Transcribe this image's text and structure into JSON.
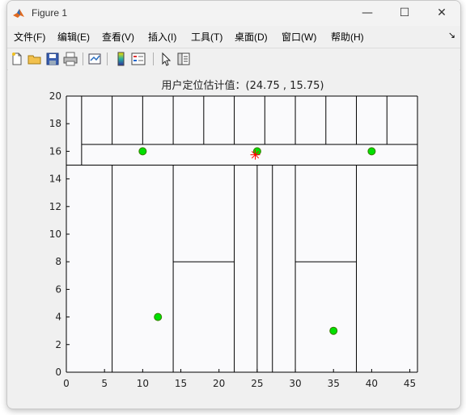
{
  "window": {
    "title": "Figure 1"
  },
  "window_controls": {
    "minimize": "—",
    "maximize": "☐",
    "close": "✕"
  },
  "menu": {
    "items": [
      {
        "label": "文件(F)"
      },
      {
        "label": "编辑(E)"
      },
      {
        "label": "查看(V)"
      },
      {
        "label": "插入(I)"
      },
      {
        "label": "工具(T)"
      },
      {
        "label": "桌面(D)"
      },
      {
        "label": "窗口(W)"
      },
      {
        "label": "帮助(H)"
      }
    ],
    "overflow_icon": "dock-arrow-icon"
  },
  "toolbar": {
    "buttons": [
      "new-figure-icon",
      "open-file-icon",
      "save-icon",
      "print-icon",
      "link-plot-icon",
      "colorbar-icon",
      "legend-icon",
      "pointer-icon",
      "property-editor-icon"
    ]
  },
  "colors": {
    "axes_background": "#fafafc",
    "wall": "#000000",
    "anchor_fill": "#00e000",
    "anchor_edge": "#3a7a00",
    "estimate_marker": "#ff0000"
  },
  "chart_data": {
    "type": "scatter",
    "title": "用户定位估计值：(24.75 , 15.75)",
    "xlabel": "",
    "ylabel": "",
    "xlim": [
      0,
      46
    ],
    "ylim": [
      0,
      20
    ],
    "xticks": [
      0,
      5,
      10,
      15,
      20,
      25,
      30,
      35,
      40,
      45
    ],
    "yticks": [
      0,
      2,
      4,
      6,
      8,
      10,
      12,
      14,
      16,
      18,
      20
    ],
    "grid": false,
    "walls": [
      [
        0,
        20,
        46,
        20
      ],
      [
        0,
        0,
        46,
        0
      ],
      [
        0,
        0,
        0,
        20
      ],
      [
        46,
        0,
        46,
        20
      ],
      [
        2,
        16.5,
        46,
        16.5
      ],
      [
        0,
        15,
        46,
        15
      ],
      [
        2,
        15,
        2,
        20
      ],
      [
        6,
        16.5,
        6,
        20
      ],
      [
        10,
        16.5,
        10,
        20
      ],
      [
        14,
        16.5,
        14,
        20
      ],
      [
        18,
        16.5,
        18,
        20
      ],
      [
        22,
        16.5,
        22,
        20
      ],
      [
        26,
        16.5,
        26,
        20
      ],
      [
        30,
        16.5,
        30,
        20
      ],
      [
        34,
        16.5,
        34,
        20
      ],
      [
        38,
        16.5,
        38,
        20
      ],
      [
        42,
        16.5,
        42,
        20
      ],
      [
        6,
        0,
        6,
        15
      ],
      [
        14,
        0,
        14,
        15
      ],
      [
        22,
        0,
        22,
        15
      ],
      [
        25,
        0,
        25,
        15
      ],
      [
        27,
        0,
        27,
        15
      ],
      [
        30,
        0,
        30,
        15
      ],
      [
        38,
        0,
        38,
        15
      ],
      [
        14,
        8,
        22,
        8
      ],
      [
        30,
        8,
        38,
        8
      ]
    ],
    "series": [
      {
        "name": "",
        "marker": "circle",
        "x": [
          10,
          25,
          40,
          12,
          35
        ],
        "y": [
          16,
          16,
          16,
          4,
          3
        ]
      },
      {
        "name": "",
        "marker": "star",
        "x": [
          24.75
        ],
        "y": [
          15.75
        ]
      }
    ]
  }
}
